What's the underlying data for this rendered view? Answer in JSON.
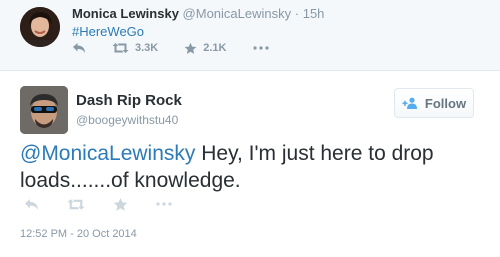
{
  "reply_context": {
    "name": "Monica Lewinsky",
    "handle": "@MonicaLewinsky",
    "separator": "·",
    "time": "15h",
    "hashtag": "#HereWeGo",
    "retweets": "3.3K",
    "favorites": "2.1K"
  },
  "tweet": {
    "name": "Dash Rip Rock",
    "handle": "@boogeywithstu40",
    "mention": "@MonicaLewinsky",
    "text": " Hey, I'm just here to drop loads.......of knowledge.",
    "timestamp": "12:52 PM - 20 Oct 2014"
  },
  "follow_button": {
    "label": "Follow"
  },
  "icons": [
    "reply-icon",
    "retweet-icon",
    "favorite-icon",
    "more-icon",
    "add-user-icon"
  ],
  "colors": {
    "link": "#2b7bb9",
    "muted": "#8899a6",
    "context_bg": "#f5f8fa",
    "text": "#292f33"
  }
}
